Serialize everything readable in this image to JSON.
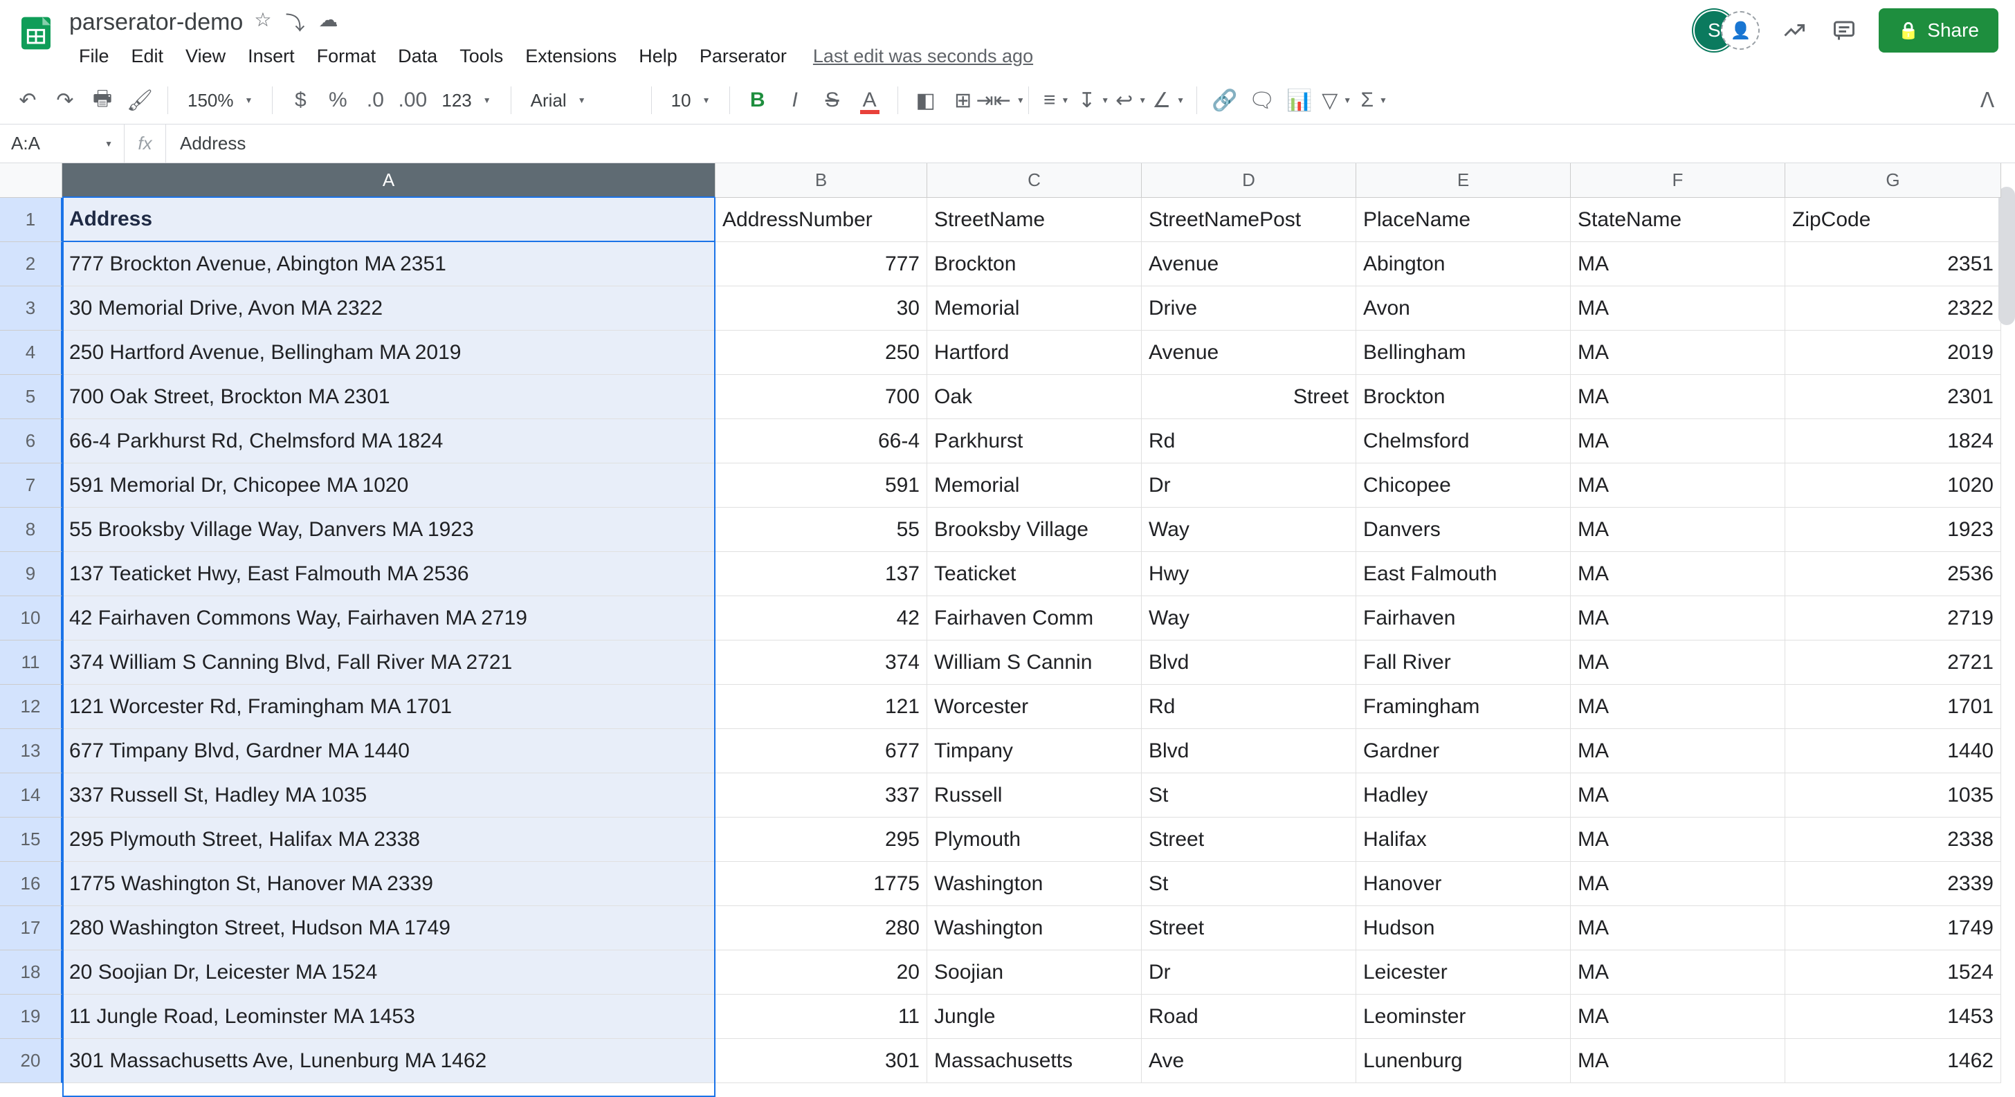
{
  "doc": {
    "title": "parserator-demo",
    "last_edit": "Last edit was seconds ago"
  },
  "menus": [
    "File",
    "Edit",
    "View",
    "Insert",
    "Format",
    "Data",
    "Tools",
    "Extensions",
    "Help",
    "Parserator"
  ],
  "toolbar": {
    "zoom": "150%",
    "font": "Arial",
    "font_size": "10"
  },
  "name_box": "A:A",
  "formula": "Address",
  "share_label": "Share",
  "avatar_letter": "S",
  "columns": [
    "A",
    "B",
    "C",
    "D",
    "E",
    "F",
    "G"
  ],
  "col_widths": [
    "colA",
    "colB",
    "colC",
    "colD",
    "colE",
    "colF",
    "colG"
  ],
  "headers": [
    "Address",
    "AddressNumber",
    "StreetName",
    "StreetNamePost",
    "PlaceName",
    "StateName",
    "ZipCode"
  ],
  "rows": [
    {
      "a": "777 Brockton Avenue, Abington MA 2351",
      "b": "777",
      "c": "Brockton",
      "d": "Avenue",
      "e": "Abington",
      "f": "MA",
      "g": "2351"
    },
    {
      "a": "30 Memorial Drive, Avon MA 2322",
      "b": "30",
      "c": "Memorial",
      "d": "Drive",
      "e": "Avon",
      "f": "MA",
      "g": "2322"
    },
    {
      "a": "250 Hartford Avenue, Bellingham MA 2019",
      "b": "250",
      "c": "Hartford",
      "d": "Avenue",
      "e": "Bellingham",
      "f": "MA",
      "g": "2019"
    },
    {
      "a": "700 Oak Street, Brockton MA 2301",
      "b": "700",
      "c": "Oak",
      "d_right": "Street",
      "e": "Brockton",
      "f": "MA",
      "g": "2301"
    },
    {
      "a": "66-4 Parkhurst Rd, Chelmsford MA 1824",
      "b": "66-4",
      "c": "Parkhurst",
      "d": "Rd",
      "e": "Chelmsford",
      "f": "MA",
      "g": "1824"
    },
    {
      "a": "591 Memorial Dr, Chicopee MA 1020",
      "b": "591",
      "c": "Memorial",
      "d": "Dr",
      "e": "Chicopee",
      "f": "MA",
      "g": "1020"
    },
    {
      "a": "55 Brooksby Village Way, Danvers MA 1923",
      "b": "55",
      "c": "Brooksby Village",
      "d": "Way",
      "e": "Danvers",
      "f": "MA",
      "g": "1923"
    },
    {
      "a": "137 Teaticket Hwy, East Falmouth MA 2536",
      "b": "137",
      "c": "Teaticket",
      "d": "Hwy",
      "e": "East Falmouth",
      "f": "MA",
      "g": "2536"
    },
    {
      "a": "42 Fairhaven Commons Way, Fairhaven MA 2719",
      "b": "42",
      "c": "Fairhaven Comm",
      "d": "Way",
      "e": "Fairhaven",
      "f": "MA",
      "g": "2719"
    },
    {
      "a": "374 William S Canning Blvd, Fall River MA 2721",
      "b": "374",
      "c": "William S Cannin",
      "d": "Blvd",
      "e": "Fall River",
      "f": "MA",
      "g": "2721"
    },
    {
      "a": "121 Worcester Rd, Framingham MA 1701",
      "b": "121",
      "c": "Worcester",
      "d": "Rd",
      "e": "Framingham",
      "f": "MA",
      "g": "1701"
    },
    {
      "a": "677 Timpany Blvd, Gardner MA 1440",
      "b": "677",
      "c": "Timpany",
      "d": "Blvd",
      "e": "Gardner",
      "f": "MA",
      "g": "1440"
    },
    {
      "a": "337 Russell St, Hadley MA 1035",
      "b": "337",
      "c": "Russell",
      "d": "St",
      "e": "Hadley",
      "f": "MA",
      "g": "1035"
    },
    {
      "a": "295 Plymouth Street, Halifax MA 2338",
      "b": "295",
      "c": "Plymouth",
      "d": "Street",
      "e": "Halifax",
      "f": "MA",
      "g": "2338"
    },
    {
      "a": "1775 Washington St, Hanover MA 2339",
      "b": "1775",
      "c": "Washington",
      "d": "St",
      "e": "Hanover",
      "f": "MA",
      "g": "2339"
    },
    {
      "a": "280 Washington Street, Hudson MA 1749",
      "b": "280",
      "c": "Washington",
      "d": "Street",
      "e": "Hudson",
      "f": "MA",
      "g": "1749"
    },
    {
      "a": "20 Soojian Dr, Leicester MA 1524",
      "b": "20",
      "c": "Soojian",
      "d": "Dr",
      "e": "Leicester",
      "f": "MA",
      "g": "1524"
    },
    {
      "a": "11 Jungle Road, Leominster MA 1453",
      "b": "11",
      "c": "Jungle",
      "d": "Road",
      "e": "Leominster",
      "f": "MA",
      "g": "1453"
    },
    {
      "a": "301 Massachusetts Ave, Lunenburg MA 1462",
      "b": "301",
      "c": "Massachusetts",
      "d": "Ave",
      "e": "Lunenburg",
      "f": "MA",
      "g": "1462"
    }
  ]
}
